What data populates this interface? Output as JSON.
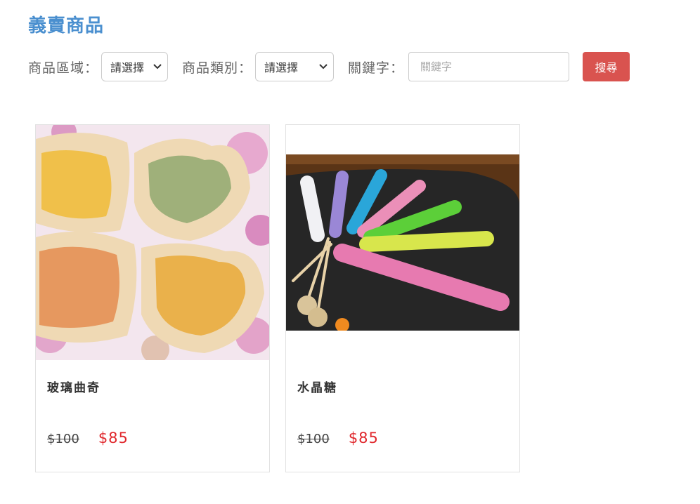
{
  "page": {
    "title": "義賣商品"
  },
  "filters": {
    "region_label": "商品區域：",
    "region_value": "請選擇",
    "category_label": "商品類別：",
    "category_value": "請選擇",
    "keyword_label": "關鍵字：",
    "keyword_placeholder": "關鍵字",
    "search_label": "搜尋"
  },
  "products": [
    {
      "name": "玻璃曲奇",
      "original_price": "$100",
      "sale_price": "$85"
    },
    {
      "name": "水晶糖",
      "original_price": "$100",
      "sale_price": "$85"
    }
  ],
  "colors": {
    "title": "#4a8fcf",
    "search_button": "#d9534f",
    "sale_price": "#e0262b"
  }
}
